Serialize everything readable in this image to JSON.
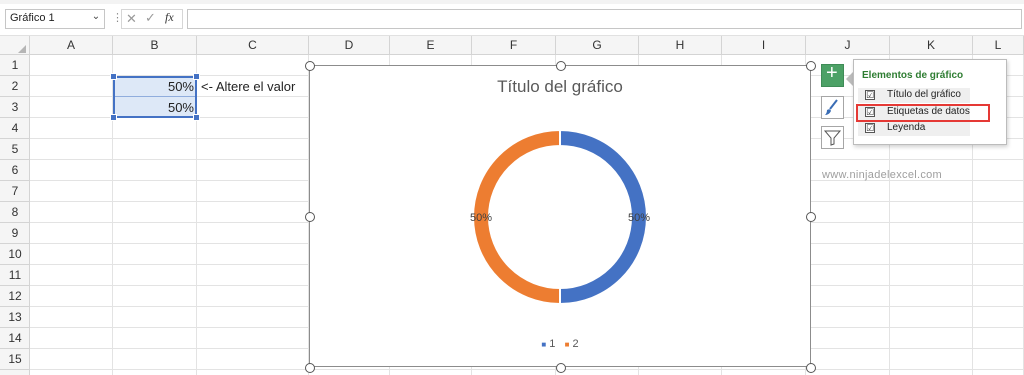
{
  "formula_bar": {
    "name_box": "Gráfico 1",
    "name_box_arrow": "⌄",
    "dots": "⋮",
    "cancel_icon": "✕",
    "enter_icon": "✓",
    "fx_label": "fx",
    "formula": ""
  },
  "grid": {
    "columns": [
      "A",
      "B",
      "C",
      "D",
      "E",
      "F",
      "G",
      "H",
      "I",
      "J",
      "K",
      "L"
    ],
    "rows": [
      "1",
      "2",
      "3",
      "4",
      "5",
      "6",
      "7",
      "8",
      "9",
      "10",
      "11",
      "12",
      "13",
      "14",
      "15"
    ]
  },
  "cells": {
    "b2": "50%",
    "b3": "50%",
    "note": "<- Altere el valor"
  },
  "chart": {
    "title": "Título del gráfico",
    "legend_prefix": "■",
    "colors": {
      "series1": "#4472c4",
      "series2": "#ed7d31"
    }
  },
  "chart_data": {
    "type": "pie",
    "variant": "doughnut",
    "title": "Título del gráfico",
    "categories": [
      "1",
      "2"
    ],
    "values": [
      50,
      50
    ],
    "data_labels": [
      "50%",
      "50%"
    ],
    "legend_position": "bottom"
  },
  "side_buttons": {
    "elements_icon": "+",
    "styles_icon": "🖌",
    "filter_icon": "⧩"
  },
  "popup": {
    "title": "Elementos de gráfico",
    "items": [
      {
        "label": "Título del gráfico",
        "checked": true,
        "check_mark": "☑"
      },
      {
        "label": "Etiquetas de datos",
        "checked": true,
        "check_mark": "☑"
      },
      {
        "label": "Leyenda",
        "checked": true,
        "check_mark": "☑"
      }
    ]
  },
  "watermark": "www.ninjadelexcel.com"
}
